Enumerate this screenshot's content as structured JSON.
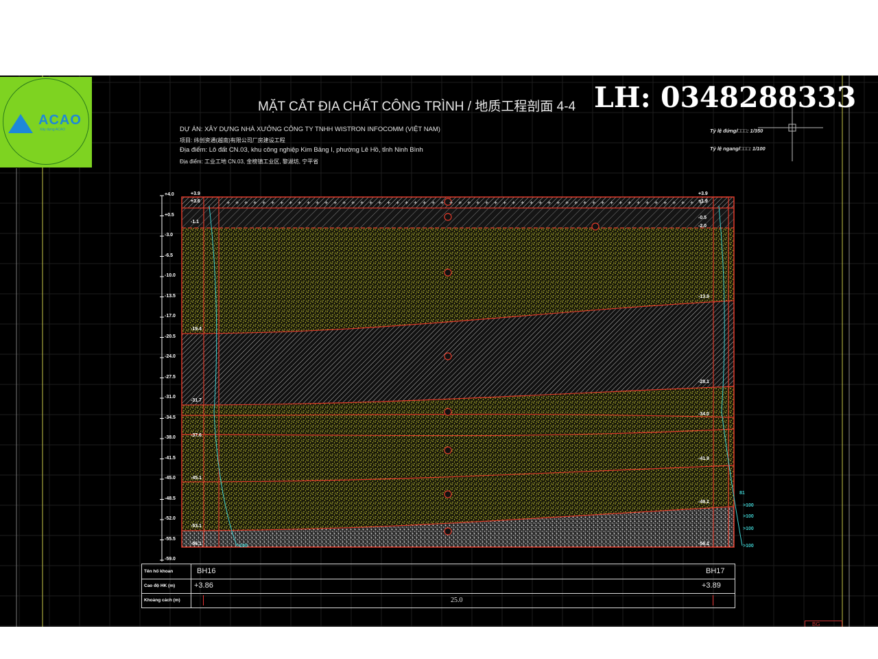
{
  "header": {
    "title": "MẶT CẮT ĐỊA CHẤT CÔNG TRÌNH / 地质工程剖面 4-4",
    "hotline": "LH: 0348288333"
  },
  "logo": {
    "brand": "ACAO",
    "tagline": "Xây dựng ACAO"
  },
  "project": {
    "line1": "DỰ ÁN: XÂY DỰNG NHÀ XƯỞNG CÔNG TY TNHH WISTRON INFOCOMM (VIỆT NAM)",
    "line2": "项目:  纬创资通(越南)有限公司厂房建设工程",
    "line3": "Địa điểm: Lô đất CN.03, khu công nghiệp Kim Bảng I, phường Lê Hồ, tỉnh Ninh Bình",
    "line4": "Địa điểm: 工业工地 CN.03, 金榜镇工业区, 黎湖坊, 宁平省"
  },
  "scale": {
    "vertical": "Tỷ lệ đứng/□□□: 1/350",
    "horizontal": "Tỷ lệ ngang/□□□: 1/100"
  },
  "axis_labels": [
    "+4.0",
    "+0.5",
    "-3.0",
    "-6.5",
    "-10.0",
    "-13.5",
    "-17.0",
    "-20.5",
    "-24.0",
    "-27.5",
    "-31.0",
    "-34.5",
    "-38.0",
    "-41.5",
    "-45.0",
    "-48.5",
    "-52.0",
    "-55.5",
    "-59.0"
  ],
  "left_labels": [
    "+3.9",
    "+3.6",
    "-1.1",
    "-19.4",
    "-31.7",
    "-37.6",
    "-45.1",
    "-53.1",
    "-56.1"
  ],
  "right_labels": [
    "+3.9",
    "+1.9",
    "-0.5",
    "-2.0",
    "-13.9",
    "-28.1",
    "-34.0",
    "-41.9",
    "-49.1",
    "-56.1"
  ],
  "blow_counts": [
    ">100",
    ">100",
    ">100",
    ">100",
    "81",
    ">100"
  ],
  "table": {
    "row1_label": "Tên hố khoan",
    "row2_label": "Cao độ HK (m)",
    "row3_label": "Khoảng cách (m)",
    "bh_left": "BH16",
    "bh_right": "BH17",
    "elev_left": "+3.86",
    "elev_right": "+3.89",
    "distance": "25.0"
  },
  "corner_mark": "BG"
}
